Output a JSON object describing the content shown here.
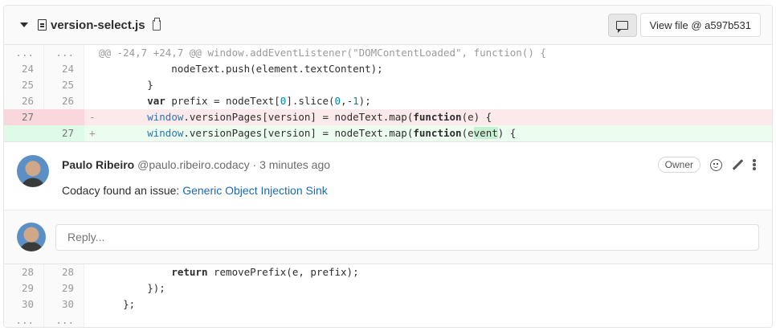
{
  "file": {
    "name": "version-select.js",
    "view_file_label": "View file @ a597b531"
  },
  "diff_top": [
    {
      "type": "hunk",
      "old": "...",
      "new": "...",
      "mark": "",
      "text": "@@ -24,7 +24,7 @@ window.addEventListener(\"DOMContentLoaded\", function() {"
    },
    {
      "type": "ctx",
      "old": "24",
      "new": "24",
      "mark": "",
      "text": "            nodeText.push(element.textContent);"
    },
    {
      "type": "ctx",
      "old": "25",
      "new": "25",
      "mark": "",
      "text": "        }"
    },
    {
      "type": "ctx",
      "old": "26",
      "new": "26",
      "mark": "",
      "text_html": "        <span class=\"kw\">var</span> prefix = nodeText[<span class=\"num\">0</span>].slice(<span class=\"num\">0</span>,-<span class=\"num\">1</span>);"
    },
    {
      "type": "old",
      "old": "27",
      "new": "",
      "mark": "-",
      "text_html": "        <span class=\"bl\">window</span>.versionPages[version] = nodeText.map(<span class=\"kw\">function</span>(e) {"
    },
    {
      "type": "new",
      "old": "",
      "new": "27",
      "mark": "+",
      "text_html": "        <span class=\"bl\">window</span>.versionPages[version] = nodeText.map(<span class=\"kw\">function</span>(e<span class=\"hl\">vent</span>) {"
    }
  ],
  "note": {
    "author": "Paulo Ribeiro",
    "handle": "@paulo.ribeiro.codacy",
    "separator": " · ",
    "time": "3 minutes ago",
    "text": "Codacy found an issue: ",
    "link": "Generic Object Injection Sink",
    "badge": "Owner"
  },
  "reply": {
    "placeholder": "Reply..."
  },
  "diff_bottom": [
    {
      "type": "ctx",
      "old": "28",
      "new": "28",
      "mark": "",
      "text_html": "            <span class=\"kw\">return</span> removePrefix(e, prefix);"
    },
    {
      "type": "ctx",
      "old": "29",
      "new": "29",
      "mark": "",
      "text": "        });"
    },
    {
      "type": "ctx",
      "old": "30",
      "new": "30",
      "mark": "",
      "text": "    };"
    },
    {
      "type": "hunk",
      "old": "...",
      "new": "...",
      "mark": "",
      "text": ""
    }
  ]
}
